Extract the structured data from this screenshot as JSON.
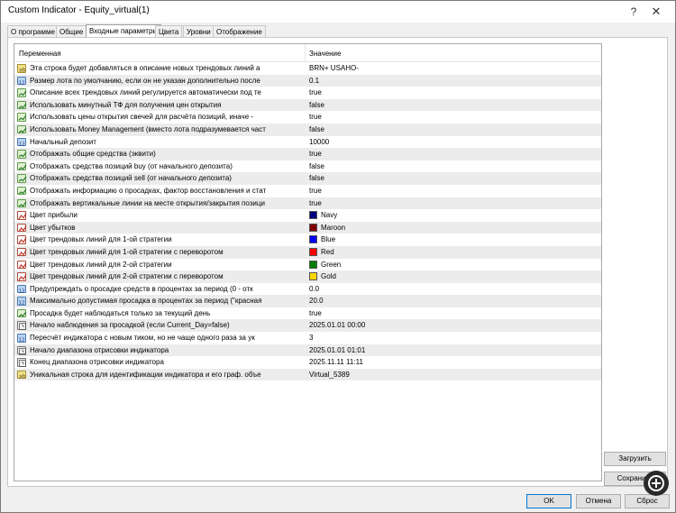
{
  "window": {
    "title": "Custom Indicator - Equity_virtual(1)",
    "help_label": "?",
    "close_label": "✕"
  },
  "tabs": [
    {
      "label": "О программе"
    },
    {
      "label": "Общие"
    },
    {
      "label": "Входные параметры",
      "active": true
    },
    {
      "label": "Цвета"
    },
    {
      "label": "Уровни"
    },
    {
      "label": "Отображение"
    }
  ],
  "grid": {
    "col_variable": "Переменная",
    "col_value": "Значение",
    "rows": [
      {
        "type": "str",
        "name": "Эта строка будет добавляться в описание новых трендовых линий а",
        "value": "BRN+ USAHO-"
      },
      {
        "type": "num",
        "name": "Размер лота по умолчанию, если он не указан дополнительно после",
        "value": "0.1"
      },
      {
        "type": "bool",
        "name": "Описание всех трендовых линий регулируется автоматически под те",
        "value": "true"
      },
      {
        "type": "bool",
        "name": "Использовать минутный ТФ для получения цен открытия",
        "value": "false"
      },
      {
        "type": "bool",
        "name": "Использовать цены открытия свечей для расчёта позиций, иначе -",
        "value": "true"
      },
      {
        "type": "bool",
        "name": "Использовать Money Management (вместо лота подразумевается част",
        "value": "false"
      },
      {
        "type": "num",
        "name": "Начальный депозит",
        "value": "10000"
      },
      {
        "type": "bool",
        "name": "Отображать общие средства (эквити)",
        "value": "true"
      },
      {
        "type": "bool",
        "name": "Отображать средства позиций buy (от начального депозита)",
        "value": "false"
      },
      {
        "type": "bool",
        "name": "Отображать средства позиций sell (от начального депозита)",
        "value": "false"
      },
      {
        "type": "bool",
        "name": "Отображать информацию о просадках, фактор восстановления и стат",
        "value": "true"
      },
      {
        "type": "bool",
        "name": "Отображать вертикальные линии на месте открытия/закрытия позици",
        "value": "true"
      },
      {
        "type": "color",
        "name": "Цвет прибыли",
        "value": "Navy",
        "color": "#000080"
      },
      {
        "type": "color",
        "name": "Цвет убытков",
        "value": "Maroon",
        "color": "#800000"
      },
      {
        "type": "color",
        "name": "Цвет трендовых линий для 1-ой стратегии",
        "value": "Blue",
        "color": "#0000ff"
      },
      {
        "type": "color",
        "name": "Цвет трендовых линий для 1-ой стратегии с переворотом",
        "value": "Red",
        "color": "#ff0000"
      },
      {
        "type": "color",
        "name": "Цвет трендовых линий для 2-ой стратегии",
        "value": "Green",
        "color": "#008000"
      },
      {
        "type": "color",
        "name": "Цвет трендовых линий для 2-ой стратегии с переворотом",
        "value": "Gold",
        "color": "#ffd700"
      },
      {
        "type": "num",
        "name": "Предупреждать о просадке средств в процентах за период (0 - отк",
        "value": "0.0"
      },
      {
        "type": "num",
        "name": "Максимально допустимая просадка в процентах за период (\"красная",
        "value": "20.0"
      },
      {
        "type": "bool",
        "name": "Просадка будет наблюдаться только за текущий день",
        "value": "true"
      },
      {
        "type": "dt",
        "name": "Начало наблюдения за просадкой (если Current_Day=false)",
        "value": "2025.01.01 00:00"
      },
      {
        "type": "num",
        "name": "Пересчёт индикатора с новым тиком, но не чаще одного раза за ук",
        "value": "3"
      },
      {
        "type": "dt",
        "name": "Начало диапазона отрисовки индикатора",
        "value": "2025.01.01 01:01"
      },
      {
        "type": "dt",
        "name": "Конец диапазона отрисовки индикатора",
        "value": "2025.11.11 11:11"
      },
      {
        "type": "str",
        "name": "Уникальная строка для идентификации индикатора и его граф. объе",
        "value": "Virtual_5389"
      }
    ]
  },
  "buttons": {
    "load": "Загрузить",
    "save": "Сохранить",
    "ok": "OK",
    "cancel": "Отмена",
    "reset": "Сброс"
  }
}
